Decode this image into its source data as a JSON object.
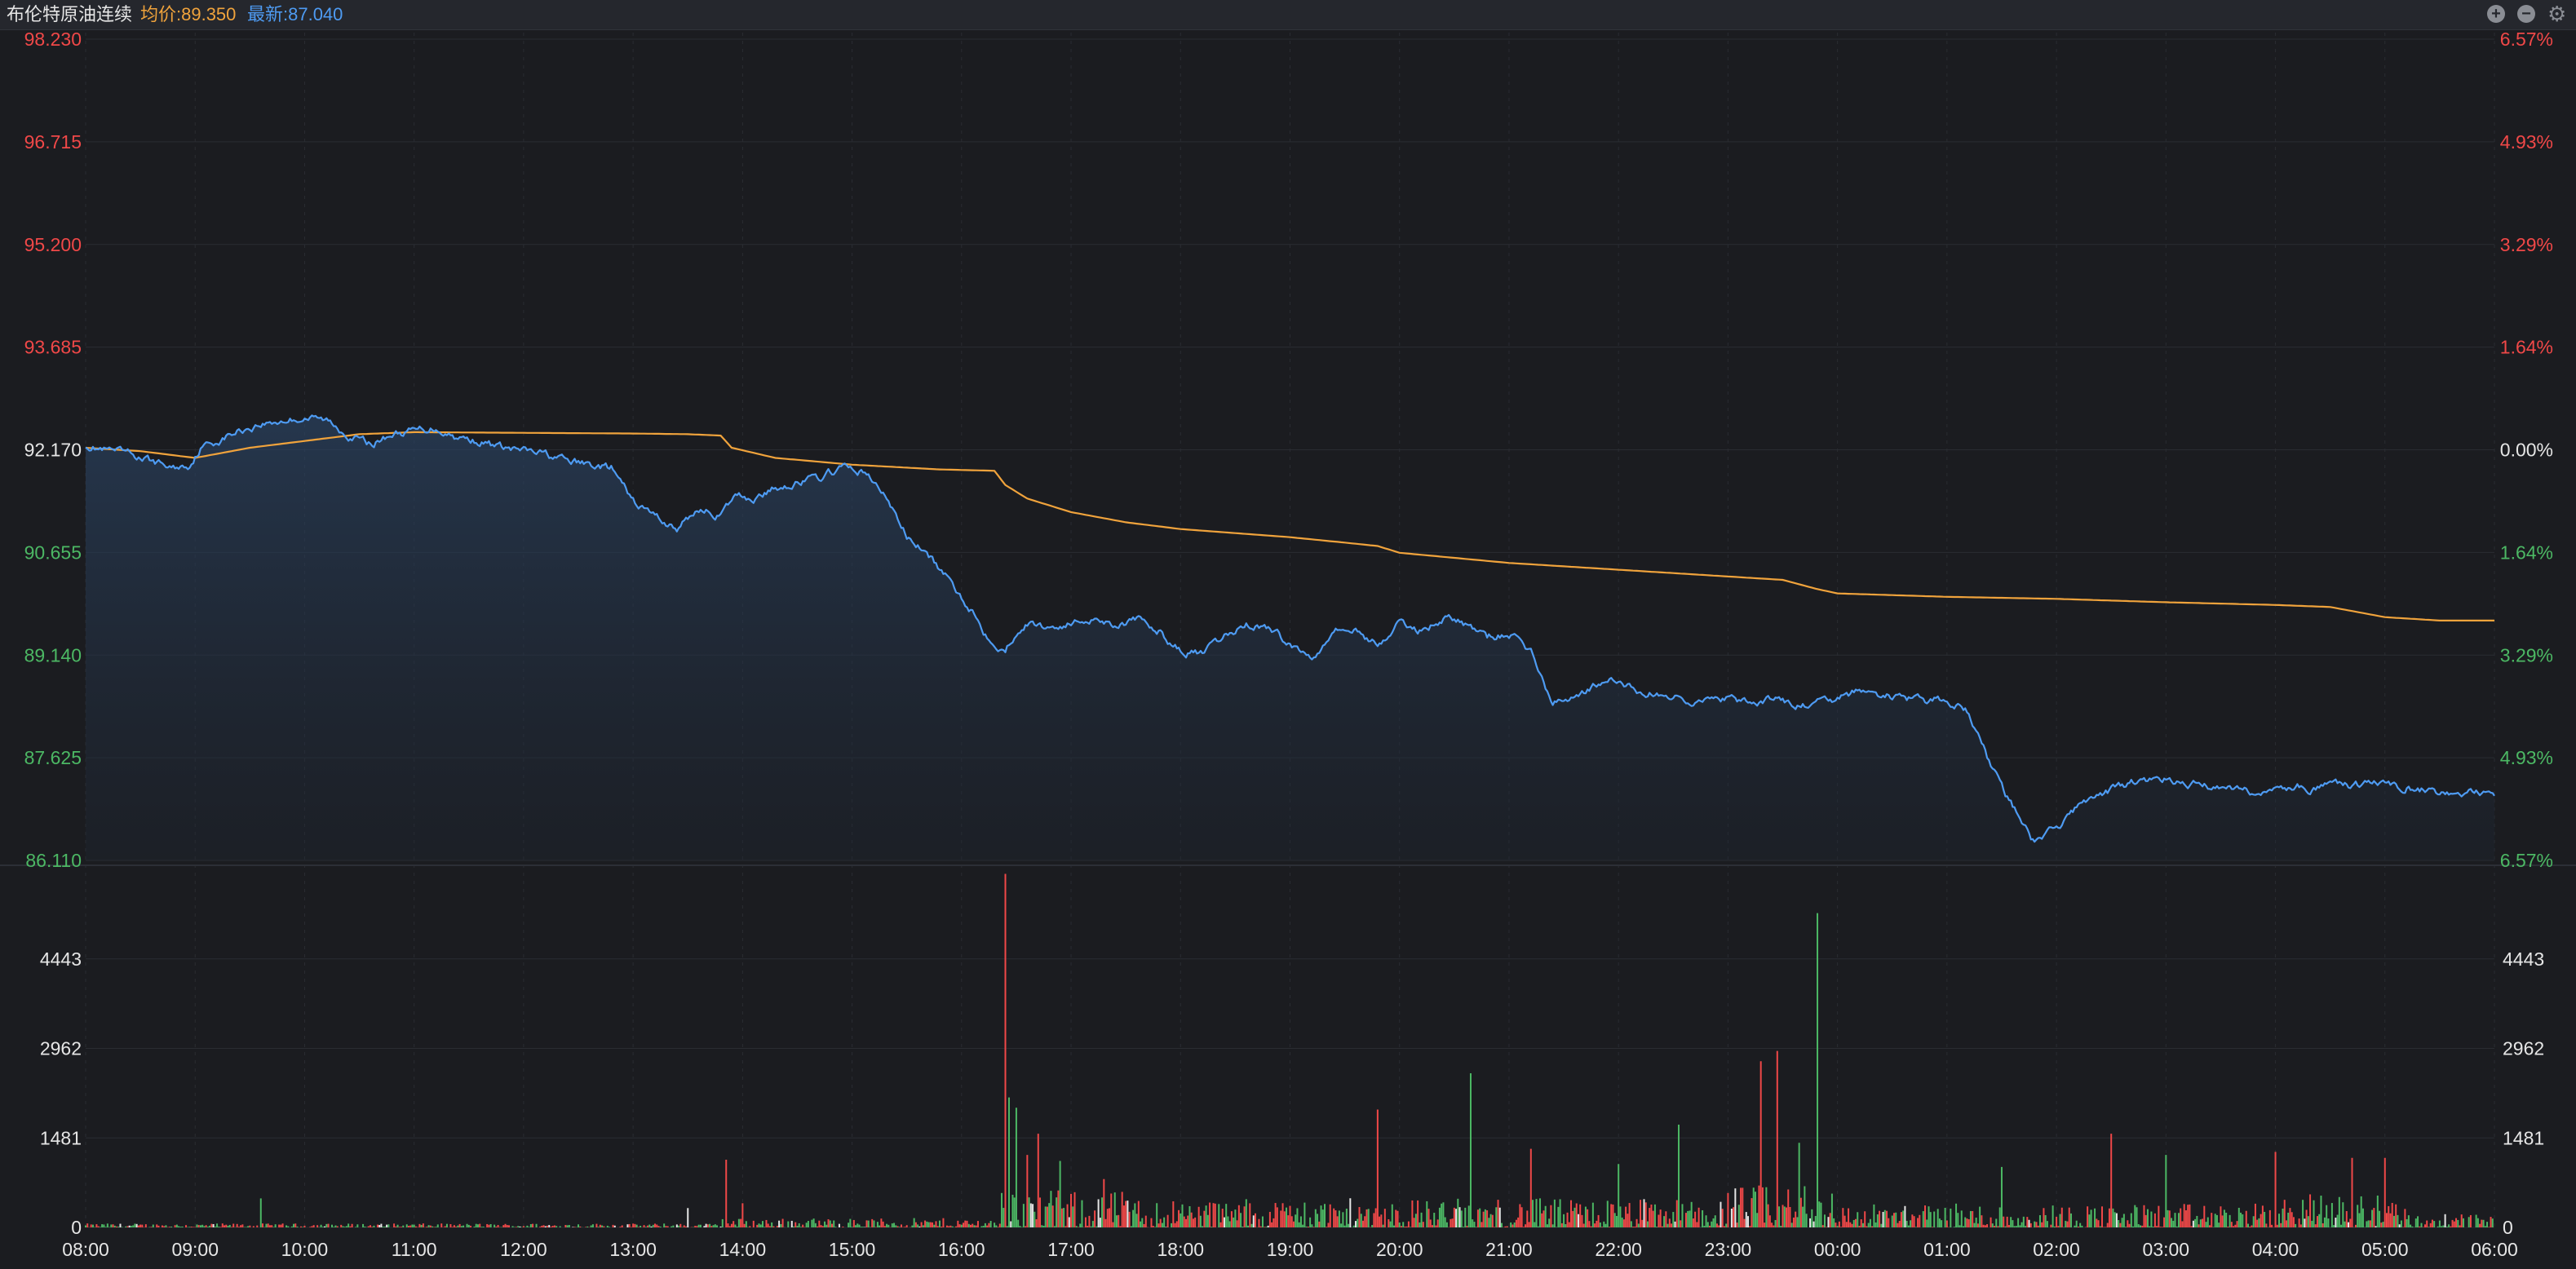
{
  "header": {
    "title": "布伦特原油连续",
    "avg_label": "均价:89.350",
    "last_label": "最新:87.040",
    "zoom_in_icon": "plus-circle-icon",
    "zoom_out_icon": "minus-circle-icon",
    "settings_icon": "gear-icon"
  },
  "colors": {
    "background": "#1b1c20",
    "grid": "#2a2c32",
    "price_line": "#4e9bf2",
    "avg_line": "#f0a33c",
    "up": "#f04848",
    "down": "#4cb864",
    "neutral": "#e6e6e6"
  },
  "chart_data": {
    "type": "line",
    "x_ticks": [
      "08:00",
      "09:00",
      "10:00",
      "11:00",
      "12:00",
      "13:00",
      "14:00",
      "15:00",
      "16:00",
      "17:00",
      "18:00",
      "19:00",
      "20:00",
      "21:00",
      "22:00",
      "23:00",
      "00:00",
      "01:00",
      "02:00",
      "03:00",
      "04:00",
      "05:00",
      "06:00"
    ],
    "x_range_hours": [
      0,
      22
    ],
    "price_axis": {
      "ylim": [
        86.11,
        98.23
      ],
      "reference": 92.17,
      "left_ticks": [
        "98.230",
        "96.715",
        "95.200",
        "93.685",
        "92.170",
        "90.655",
        "89.140",
        "87.625",
        "86.110"
      ],
      "right_ticks": [
        "6.57%",
        "4.93%",
        "3.29%",
        "1.64%",
        "0.00%",
        "1.64%",
        "3.29%",
        "4.93%",
        "6.57%"
      ]
    },
    "volume_axis": {
      "ylim": [
        0,
        5924
      ],
      "ticks": [
        "0",
        "1481",
        "2962",
        "4443"
      ]
    },
    "series": [
      {
        "key": "price",
        "x": [
          0,
          0.2,
          0.4,
          0.6,
          0.8,
          0.95,
          1.05,
          1.2,
          1.4,
          1.6,
          1.8,
          2.0,
          2.2,
          2.4,
          2.6,
          2.8,
          3.0,
          3.2,
          3.4,
          3.6,
          3.8,
          4.0,
          4.2,
          4.4,
          4.6,
          4.8,
          5.0,
          5.2,
          5.4,
          5.6,
          5.8,
          5.95,
          6.1,
          6.3,
          6.5,
          6.7,
          6.9,
          7.1,
          7.3,
          7.5,
          7.7,
          7.9,
          8.1,
          8.2,
          8.3,
          8.4,
          8.5,
          8.6,
          8.8,
          9.0,
          9.2,
          9.4,
          9.6,
          9.8,
          10.0,
          10.2,
          10.4,
          10.6,
          10.8,
          11.0,
          11.2,
          11.4,
          11.6,
          11.8,
          12.0,
          12.2,
          12.4,
          12.6,
          12.8,
          13.0,
          13.2,
          13.4,
          13.6,
          13.8,
          14.0,
          14.2,
          14.4,
          14.6,
          14.8,
          15.0,
          15.2,
          15.4,
          15.6,
          15.8,
          16.0,
          16.2,
          16.4,
          16.6,
          16.8,
          17.0,
          17.2,
          17.4,
          17.6,
          17.8,
          18.0,
          18.2,
          18.4,
          18.6,
          18.8,
          19.0,
          19.2,
          19.4,
          19.6,
          19.8,
          20.0,
          20.2,
          20.35,
          20.5,
          20.6,
          20.7,
          20.85,
          21.0,
          21.2,
          21.4,
          21.6,
          21.8,
          22.0
        ],
        "values": [
          92.25,
          92.15,
          92.1,
          92.0,
          91.9,
          91.95,
          92.2,
          92.3,
          92.45,
          92.55,
          92.6,
          92.65,
          92.6,
          92.4,
          92.25,
          92.4,
          92.45,
          92.5,
          92.35,
          92.3,
          92.2,
          92.15,
          92.1,
          92.0,
          91.95,
          91.9,
          91.4,
          91.2,
          91.0,
          91.3,
          91.2,
          91.5,
          91.45,
          91.6,
          91.7,
          91.75,
          91.9,
          91.85,
          91.5,
          90.9,
          90.6,
          90.2,
          89.8,
          89.5,
          89.35,
          89.2,
          89.5,
          89.6,
          89.55,
          89.6,
          89.7,
          89.6,
          89.65,
          89.5,
          89.2,
          89.15,
          89.4,
          89.6,
          89.55,
          89.3,
          89.1,
          89.55,
          89.5,
          89.3,
          89.6,
          89.5,
          89.7,
          89.6,
          89.4,
          89.45,
          89.2,
          88.4,
          88.55,
          88.7,
          88.75,
          88.6,
          88.55,
          88.5,
          88.45,
          88.5,
          88.4,
          88.5,
          88.4,
          88.4,
          88.5,
          88.6,
          88.55,
          88.5,
          88.45,
          88.5,
          88.3,
          87.5,
          86.9,
          86.35,
          86.6,
          86.9,
          87.1,
          87.2,
          87.3,
          87.3,
          87.25,
          87.2,
          87.2,
          87.1,
          87.15,
          87.2,
          87.15,
          87.2,
          87.25,
          87.2,
          87.25,
          87.2,
          87.2,
          87.15,
          87.1,
          87.1,
          87.05
        ]
      },
      {
        "key": "average",
        "x": [
          0,
          0.5,
          1.0,
          1.5,
          2.0,
          2.5,
          3.0,
          4.0,
          5.0,
          5.5,
          5.8,
          5.9,
          6.3,
          7.0,
          7.8,
          8.3,
          8.4,
          8.6,
          9.0,
          9.5,
          10.0,
          11.0,
          11.5,
          11.8,
          12.0,
          13.0,
          14.0,
          15.0,
          15.5,
          15.8,
          16.0,
          17.0,
          18.0,
          19.0,
          20.0,
          20.5,
          21.0,
          21.5,
          22.0
        ],
        "values": [
          92.2,
          92.15,
          92.05,
          92.2,
          92.3,
          92.4,
          92.43,
          92.42,
          92.41,
          92.4,
          92.38,
          92.2,
          92.05,
          91.95,
          91.88,
          91.86,
          91.65,
          91.45,
          91.25,
          91.1,
          91.0,
          90.88,
          90.8,
          90.75,
          90.65,
          90.5,
          90.4,
          90.3,
          90.25,
          90.12,
          90.05,
          90.0,
          89.97,
          89.92,
          89.88,
          89.85,
          89.7,
          89.65,
          89.65
        ]
      }
    ],
    "volume": {
      "ylim": [
        0,
        5924
      ],
      "peaks": [
        {
          "t": 1.6,
          "v": 480,
          "dir": "up"
        },
        {
          "t": 5.5,
          "v": 320,
          "dir": "neutral"
        },
        {
          "t": 5.85,
          "v": 1120,
          "dir": "down"
        },
        {
          "t": 6.0,
          "v": 400,
          "dir": "down"
        },
        {
          "t": 8.4,
          "v": 5850,
          "dir": "down"
        },
        {
          "t": 8.43,
          "v": 2150,
          "dir": "up"
        },
        {
          "t": 8.5,
          "v": 1980,
          "dir": "up"
        },
        {
          "t": 8.6,
          "v": 1200,
          "dir": "down"
        },
        {
          "t": 8.7,
          "v": 1550,
          "dir": "down"
        },
        {
          "t": 8.9,
          "v": 1100,
          "dir": "up"
        },
        {
          "t": 9.3,
          "v": 800,
          "dir": "down"
        },
        {
          "t": 11.8,
          "v": 1950,
          "dir": "down"
        },
        {
          "t": 12.65,
          "v": 2550,
          "dir": "up"
        },
        {
          "t": 13.2,
          "v": 1300,
          "dir": "down"
        },
        {
          "t": 14.0,
          "v": 1050,
          "dir": "up"
        },
        {
          "t": 14.55,
          "v": 1700,
          "dir": "up"
        },
        {
          "t": 15.3,
          "v": 2750,
          "dir": "down"
        },
        {
          "t": 15.45,
          "v": 2920,
          "dir": "down"
        },
        {
          "t": 15.65,
          "v": 1400,
          "dir": "up"
        },
        {
          "t": 15.82,
          "v": 5200,
          "dir": "up"
        },
        {
          "t": 17.5,
          "v": 1000,
          "dir": "up"
        },
        {
          "t": 18.5,
          "v": 1550,
          "dir": "down"
        },
        {
          "t": 19.0,
          "v": 1200,
          "dir": "up"
        },
        {
          "t": 20.0,
          "v": 1250,
          "dir": "down"
        },
        {
          "t": 20.7,
          "v": 1150,
          "dir": "down"
        },
        {
          "t": 21.0,
          "v": 1150,
          "dir": "down"
        }
      ]
    },
    "grid": true,
    "legend": "none"
  }
}
